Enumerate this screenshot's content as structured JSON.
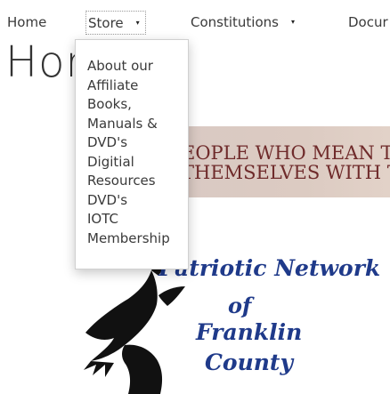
{
  "nav": {
    "home": "Home",
    "store": "Store",
    "constitutions": "Constitutions",
    "documents": "Docur",
    "caret": "▾"
  },
  "page": {
    "title": "Hor"
  },
  "dropdown": {
    "items": [
      "About our",
      "Affiliate",
      "Books,",
      "Manuals &",
      "DVD's",
      "Digitial",
      "Resources",
      "DVD's",
      "IOTC",
      "Membership"
    ]
  },
  "banner": {
    "line1": "EOPLE WHO MEAN T",
    "line2": "THEMSELVES WITH T",
    "text_color": "#6f2b2b"
  },
  "logo": {
    "line1": "Patriotic Network",
    "line2": "of",
    "line3": "Franklin",
    "line4": "County",
    "text_color": "#1f3a8a",
    "icon": "eagle-icon"
  }
}
